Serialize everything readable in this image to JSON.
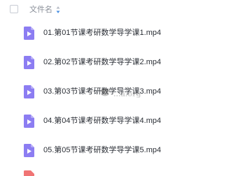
{
  "header": {
    "column_name": "文件名",
    "sort_icon": "sort-arrows-icon"
  },
  "files": [
    {
      "name": "01.第01节课考研数学导学课1.mp4",
      "icon": "video-file-icon",
      "color": "#8c7df2"
    },
    {
      "name": "02.第02节课考研数学导学课2.mp4",
      "icon": "video-file-icon",
      "color": "#8c7df2"
    },
    {
      "name": "03.第03节课考研数学导学课3.mp4",
      "icon": "video-file-icon",
      "color": "#8c7df2"
    },
    {
      "name": "04.第04节课考研数学导学课4.mp4",
      "icon": "video-file-icon",
      "color": "#8c7df2"
    },
    {
      "name": "05.第05节课考研数学导学课5.mp4",
      "icon": "video-file-icon",
      "color": "#8c7df2"
    }
  ],
  "watermark": {
    "text": "...a.org"
  },
  "partial_row": {
    "icon": "document-file-icon",
    "color": "#f07474"
  }
}
